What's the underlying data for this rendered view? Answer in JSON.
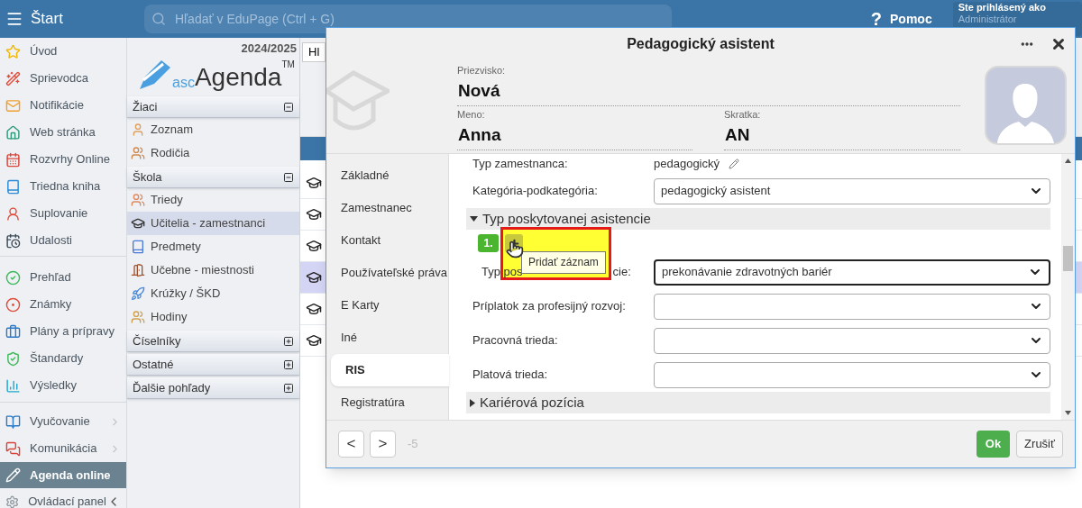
{
  "top_bar": {
    "menu_label": "Štart",
    "search": {
      "placeholder": "Hľadať v EduPage (Ctrl + G)"
    },
    "help_glyph": "?",
    "help": "Pomoc",
    "login": {
      "title": "Ste prihlásený ako",
      "user": "Administrátor"
    }
  },
  "sidebar": {
    "groups": [
      [
        {
          "label": "Úvod",
          "kind": "link",
          "selected": false
        },
        {
          "label": "Sprievodca",
          "kind": "link",
          "selected": false
        },
        {
          "label": "Notifikácie",
          "kind": "link",
          "selected": false
        },
        {
          "label": "Web stránka",
          "kind": "link",
          "selected": false
        },
        {
          "label": "Rozvrhy Online",
          "kind": "link",
          "selected": false
        },
        {
          "label": "Triedna kniha",
          "kind": "link",
          "selected": false
        },
        {
          "label": "Suplovanie",
          "kind": "link",
          "selected": false
        },
        {
          "label": "Udalosti",
          "kind": "link",
          "selected": false
        }
      ],
      [
        {
          "label": "Prehľad",
          "kind": "link",
          "selected": false
        },
        {
          "label": "Známky",
          "kind": "link",
          "selected": false
        },
        {
          "label": "Plány a prípravy",
          "kind": "link",
          "selected": false
        },
        {
          "label": "Štandardy",
          "kind": "link",
          "selected": false
        },
        {
          "label": "Výsledky",
          "kind": "link",
          "selected": false
        }
      ],
      [
        {
          "label": "Vyučovanie",
          "kind": "submenu",
          "selected": false
        },
        {
          "label": "Komunikácia",
          "kind": "submenu",
          "selected": false
        },
        {
          "label": "Agenda online",
          "kind": "link",
          "selected": true
        },
        {
          "label": "Ovládací panel",
          "kind": "collapse",
          "selected": false
        }
      ]
    ]
  },
  "agenda": {
    "year": "2024/2025",
    "logo": {
      "prefix": "asc",
      "name": "Agenda",
      "mark": "TM"
    },
    "sections": [
      {
        "title": "Žiaci",
        "expanded": true,
        "items": [
          {
            "label": "Zoznam",
            "selected": false
          },
          {
            "label": "Rodičia",
            "selected": false
          }
        ]
      },
      {
        "title": "Škola",
        "expanded": true,
        "items": [
          {
            "label": "Triedy",
            "selected": false
          },
          {
            "label": "Učitelia - zamestnanci",
            "selected": true
          },
          {
            "label": "Predmety",
            "selected": false
          },
          {
            "label": "Učebne - miestnosti",
            "selected": false
          },
          {
            "label": "Krúžky / ŠKD",
            "selected": false
          },
          {
            "label": "Hodiny",
            "selected": false
          }
        ]
      },
      {
        "title": "Číselníky",
        "expanded": false
      },
      {
        "title": "Ostatné",
        "expanded": false
      },
      {
        "title": "Ďalšie pohľady",
        "expanded": false
      }
    ]
  },
  "background": {
    "tab": "Hl",
    "rows": [
      {
        "selected": false
      },
      {
        "selected": false
      },
      {
        "selected": false
      },
      {
        "selected": true
      },
      {
        "selected": false
      },
      {
        "selected": false
      }
    ]
  },
  "dialog": {
    "title": "Pedagogický asistent",
    "fields": [
      {
        "label": "Priezvisko:",
        "value": "Nová"
      },
      {
        "label": "Meno:",
        "value": "Anna"
      },
      {
        "label": "Skratka:",
        "value": "AN"
      }
    ],
    "tabs": [
      {
        "label": "Základné",
        "selected": false
      },
      {
        "label": "Zamestnanec",
        "selected": false
      },
      {
        "label": "Kontakt",
        "selected": false
      },
      {
        "label": "Používateľské práva",
        "selected": false
      },
      {
        "label": "E Karty",
        "selected": false
      },
      {
        "label": "Iné",
        "selected": false
      },
      {
        "label": "RIS",
        "selected": true
      },
      {
        "label": "Registratúra",
        "selected": false
      }
    ],
    "rows": [
      {
        "kind": "static",
        "label": "Typ zamestnanca:",
        "value": "pedagogický"
      },
      {
        "kind": "select",
        "label": "Kategória-podkategória:",
        "value": "pedagogický asistent",
        "focused": false
      },
      {
        "kind": "section",
        "title": "Typ poskytovanej asistencie",
        "expanded": true
      },
      {
        "kind": "record",
        "number": "1.",
        "tooltip": "Pridať záznam",
        "highlighted": true
      },
      {
        "kind": "select",
        "label_parts": [
          "Typ pos",
          "cie:"
        ],
        "value": "prekonávanie zdravotných bariér",
        "focused": true
      },
      {
        "kind": "select",
        "label": "Príplatok za profesijný rozvoj:",
        "focused": false
      },
      {
        "kind": "select",
        "label": "Pracovná trieda:",
        "focused": false
      },
      {
        "kind": "select",
        "label": "Platová trieda:",
        "focused": false
      },
      {
        "kind": "section",
        "title": "Kariérová pozícia",
        "expanded": false
      }
    ],
    "footer": {
      "prev": "<",
      "next": ">",
      "counter": "-5",
      "ok": "Ok",
      "cancel": "Zrušiť"
    }
  }
}
